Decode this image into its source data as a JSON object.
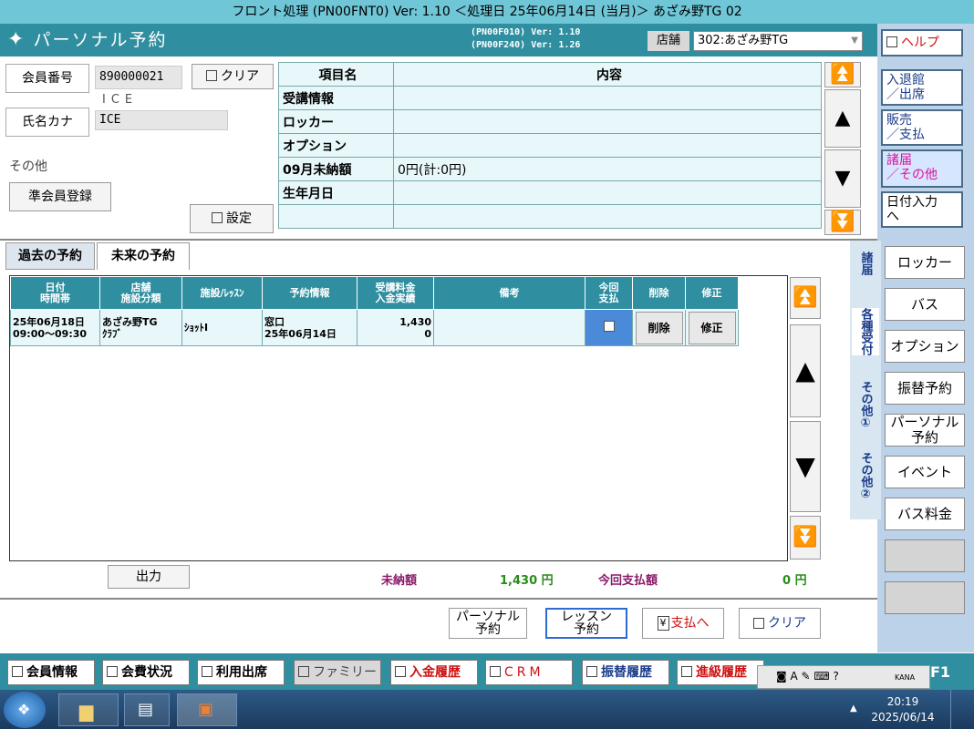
{
  "window": {
    "title": "フロント処理 (PN00FNT0) Ver: 1.10 ＜処理日 25年06月14日 (当月)＞ あざみ野TG 02"
  },
  "header": {
    "title": "パーソナル予約",
    "versions": [
      "(PN00F010) Ver: 1.10",
      "(PN00F240) Ver: 1.26"
    ],
    "store_label": "店舗",
    "store_value": "302:あざみ野TG"
  },
  "member": {
    "number_label": "会員番号",
    "number_value": "890000021",
    "name_sub": "ICE",
    "kana_label": "氏名カナ",
    "kana_value": "ICE",
    "other_label": "その他",
    "clear_label": "クリア",
    "sub_member_label": "準会員登録",
    "settings_label": "設定"
  },
  "info_table": {
    "headers": [
      "項目名",
      "内容"
    ],
    "rows": [
      {
        "key": "受講情報",
        "value": ""
      },
      {
        "key": "ロッカー",
        "value": ""
      },
      {
        "key": "オプション",
        "value": ""
      },
      {
        "key": "09月未納額",
        "value": "0円(計:0円)"
      },
      {
        "key": "生年月日",
        "value": ""
      },
      {
        "key": "",
        "value": ""
      }
    ]
  },
  "tabs": {
    "past": "過去の予約",
    "future": "未来の予約"
  },
  "reservation_table": {
    "headers": {
      "date": [
        "日付",
        "時間帯"
      ],
      "store": [
        "店舗",
        "施設分類"
      ],
      "facility": "施設/ﾚｯｽﾝ",
      "info": "予約情報",
      "fee": [
        "受講料金",
        "入金実績"
      ],
      "note": "備考",
      "pay": [
        "今回",
        "支払"
      ],
      "delete": "削除",
      "edit": "修正"
    },
    "rows": [
      {
        "date": "25年06月18日",
        "time": "09:00～09:30",
        "store": "あざみ野TG",
        "category": "ｸﾗﾌﾞ",
        "facility": "ｼｮｯﾄⅠ",
        "info1": "窓口",
        "info2": "25年06月14日",
        "fee": "1,430",
        "paid": "0",
        "note": "",
        "delete_label": "削除",
        "edit_label": "修正"
      }
    ]
  },
  "totals": {
    "output_label": "出力",
    "unpaid_label": "未納額",
    "unpaid_value": "1,430 円",
    "pay_label": "今回支払額",
    "pay_value": "0 円"
  },
  "actions": {
    "personal": [
      "パーソナル",
      "予約"
    ],
    "lesson": [
      "レッスン",
      "予約"
    ],
    "payment": "支払へ",
    "clear": "クリア"
  },
  "side_tabs": [
    "諸届",
    "各種受付",
    "その他①",
    "その他②"
  ],
  "right_menu": {
    "help": "ヘルプ",
    "entry": [
      "入退館",
      "／出席"
    ],
    "sales": [
      "販売",
      "／支払"
    ],
    "notice": [
      "諸届",
      "／その他"
    ],
    "date_input": [
      "日付入力",
      "へ"
    ],
    "sub": [
      "ロッカー",
      "バス",
      "オプション",
      "振替予約",
      "パーソナル予約",
      "イベント",
      "バス料金"
    ]
  },
  "footer": [
    "会員情報",
    "会費状況",
    "利用出席",
    "ファミリー",
    "入金履歴",
    "CRM",
    "振替履歴",
    "進級履歴"
  ],
  "ime": {
    "label": "F1",
    "kana": "KANA"
  },
  "taskbar": {
    "time": "20:19",
    "date": "2025/06/14"
  }
}
